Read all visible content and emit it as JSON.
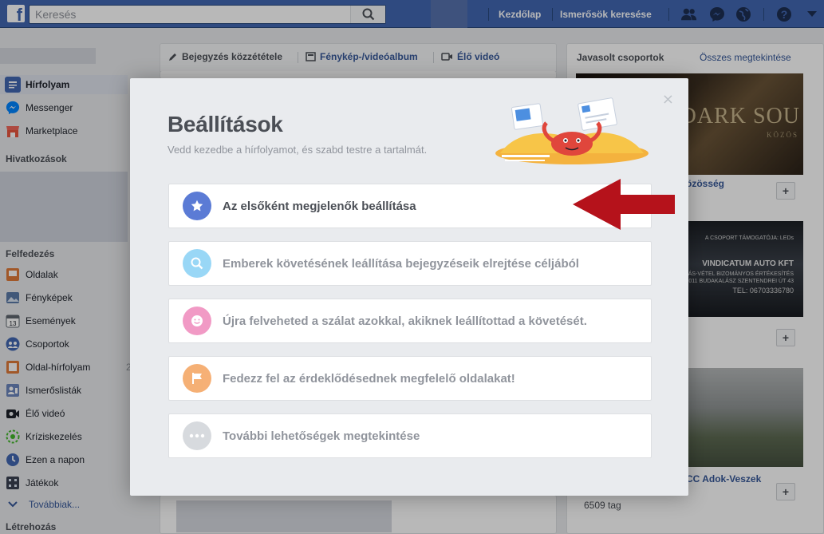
{
  "header": {
    "logo_letter": "f",
    "search_placeholder": "Keresés",
    "nav": [
      "Kezdőlap",
      "Ismerősök keresése"
    ]
  },
  "sidebar": {
    "items_top": [
      {
        "label": "Hírfolyam",
        "icon": "news-feed-icon",
        "active": true
      },
      {
        "label": "Messenger",
        "icon": "messenger-icon"
      },
      {
        "label": "Marketplace",
        "icon": "marketplace-icon"
      }
    ],
    "section_shortcuts": "Hivatkozások",
    "section_explore": "Felfedezés",
    "explore_items": [
      {
        "label": "Oldalak",
        "icon": "pages-flag-icon"
      },
      {
        "label": "Fényképek",
        "icon": "photos-icon"
      },
      {
        "label": "Események",
        "icon": "events-calendar-icon"
      },
      {
        "label": "Csoportok",
        "icon": "groups-icon"
      },
      {
        "label": "Oldal-hírfolyam",
        "icon": "pages-feed-icon",
        "badge": "2"
      },
      {
        "label": "Ismerőslisták",
        "icon": "friend-lists-icon"
      },
      {
        "label": "Élő videó",
        "icon": "live-video-icon"
      },
      {
        "label": "Kríziskezelés",
        "icon": "crisis-response-icon"
      },
      {
        "label": "Ezen a napon",
        "icon": "on-this-day-icon"
      },
      {
        "label": "Játékok",
        "icon": "games-icon"
      }
    ],
    "more_label": "Továbbiak...",
    "section_create": "Létrehozás"
  },
  "composer": {
    "tabs": [
      "Bejegyzés közzététele",
      "Fénykép-/videóalbum",
      "Élő videó"
    ]
  },
  "right": {
    "title": "Javasolt csoportok",
    "see_all": "Összes megtekintése",
    "groups": [
      {
        "name_visible": "özösség",
        "img_text": "DARK SOU",
        "img_sub": "KÖZÖS"
      },
      {
        "name_visible": "",
        "img_text": "VINDICATUM AUTO KFT",
        "img_line1": "AUTÓ ADÁS-VÉTEL BIZOMÁNYOS ÉRTÉKESÍTÉS",
        "img_line2": "2011 BUDAKALÁSZ SZENTENDREI ÚT 43",
        "img_line3": "TEL: 06703336780",
        "img_top": "A CSOPORT TÁMOGATÓJA: LEDs"
      },
      {
        "name_visible": "CC Adok-Veszek",
        "members": "6509 tag"
      }
    ],
    "plus": "+"
  },
  "modal": {
    "title": "Beállítások",
    "subtitle": "Vedd kezedbe a hírfolyamot, és szabd testre a tartalmát.",
    "close": "×",
    "options": [
      {
        "label": "Az elsőként megjelenők beállítása",
        "icon": "star-icon",
        "color": "#5b7bd5",
        "dim": false
      },
      {
        "label": "Emberek követésének leállítása bejegyzéseik elrejtése céljából",
        "icon": "magnifier-icon",
        "color": "#57bdf1",
        "dim": true
      },
      {
        "label": "Újra felveheted a szálat azokkal, akiknek leállítottad a követését.",
        "icon": "smiley-icon",
        "color": "#e8589f",
        "dim": true
      },
      {
        "label": "Fedezz fel az érdeklődésednek megfelelő oldalakat!",
        "icon": "flag-icon",
        "color": "#f07c1b",
        "dim": true
      },
      {
        "label": "További lehetőségek megtekintése",
        "icon": "more-dots-icon",
        "color": "#bec3c9",
        "dim": true
      }
    ]
  },
  "colors": {
    "topbar": "#4267b2",
    "link": "#365899",
    "arrow": "#b5121b"
  }
}
